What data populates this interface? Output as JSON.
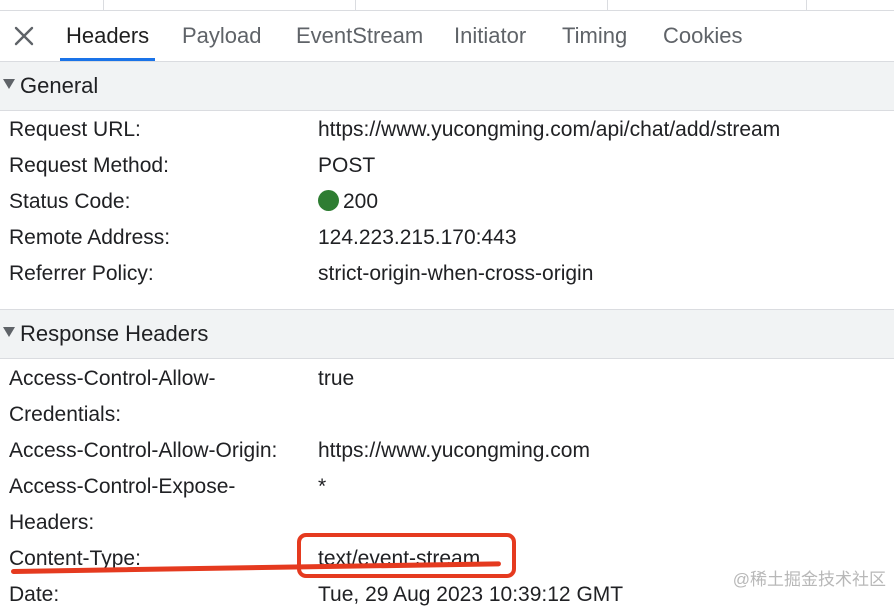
{
  "tabs": [
    {
      "label": "Headers",
      "active": true
    },
    {
      "label": "Payload"
    },
    {
      "label": "EventStream"
    },
    {
      "label": "Initiator"
    },
    {
      "label": "Timing"
    },
    {
      "label": "Cookies"
    }
  ],
  "general": {
    "title": "General",
    "rows": [
      {
        "key": "Request URL:",
        "value": "https://www.yucongming.com/api/chat/add/stream"
      },
      {
        "key": "Request Method:",
        "value": "POST"
      },
      {
        "key": "Status Code:",
        "value": "200",
        "status_color": "#2e7d32"
      },
      {
        "key": "Remote Address:",
        "value": "124.223.215.170:443"
      },
      {
        "key": "Referrer Policy:",
        "value": "strict-origin-when-cross-origin"
      }
    ]
  },
  "response_headers": {
    "title": "Response Headers",
    "rows": [
      {
        "key_line1": "Access-Control-Allow-",
        "key_line2": "Credentials:",
        "value": "true"
      },
      {
        "key": "Access-Control-Allow-Origin:",
        "value": "https://www.yucongming.com"
      },
      {
        "key_line1": "Access-Control-Expose-",
        "key_line2": "Headers:",
        "value": "*"
      },
      {
        "key": "Content-Type:",
        "value": "text/event-stream",
        "highlighted": true
      },
      {
        "key": "Date:",
        "value": "Tue, 29 Aug 2023 10:39:12 GMT"
      }
    ]
  },
  "colors": {
    "accent": "#1a73e8",
    "annotation": "#e53a1f",
    "status_ok": "#2e7d32"
  },
  "watermark": "@稀土掘金技术社区"
}
